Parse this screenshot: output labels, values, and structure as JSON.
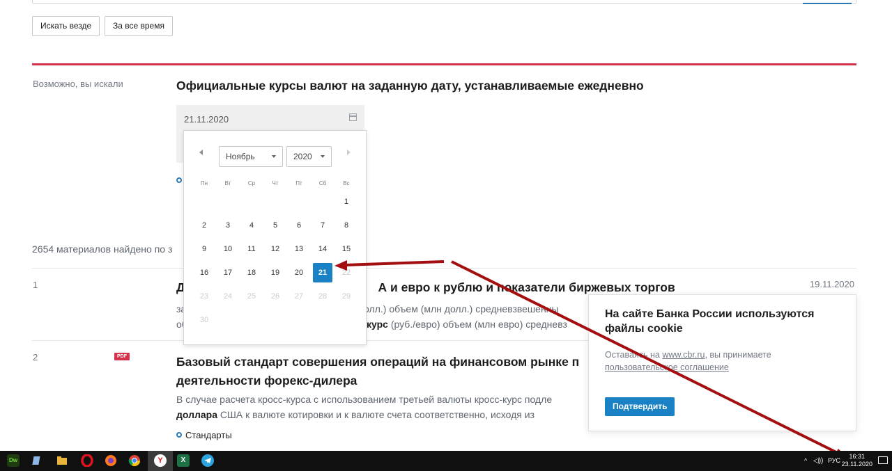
{
  "filters": {
    "search_everywhere": "Искать везде",
    "all_time": "За все время"
  },
  "suggestion": {
    "label": "Возможно, вы искали",
    "title": "Официальные курсы валют на заданную дату, устанавливаемые ежедневно",
    "date_value": "21.11.2020"
  },
  "datepicker": {
    "month": "Ноябрь",
    "year": "2020",
    "weekdays": [
      "Пн",
      "Вт",
      "Ср",
      "Чт",
      "Пт",
      "Сб",
      "Вс"
    ],
    "selected_day": "21",
    "days": [
      "1",
      "2",
      "3",
      "4",
      "5",
      "6",
      "7",
      "8",
      "9",
      "10",
      "11",
      "12",
      "13",
      "14",
      "15",
      "16",
      "17",
      "18",
      "19",
      "20",
      "21",
      "22",
      "23",
      "24",
      "25",
      "26",
      "27",
      "28",
      "29",
      "30"
    ]
  },
  "results": {
    "count_text": "2654 материалов найдено по з",
    "items": [
      {
        "num": "1",
        "title_left": "Д",
        "title_right": "А и евро к рублю и показатели биржевых торгов",
        "date": "19.11.2020",
        "line1_left": "за",
        "line1_right": "/долл.) объем (млн долл.) средневзвешенны",
        "line2_left": "об",
        "line2_bold": "курс",
        "line2_right": "(руб./евро) объем (млн евро) средневз"
      },
      {
        "num": "2",
        "badge": "PDF",
        "title": "Базовый стандарт совершения операций на финансовом рынке п деятельности форекс-дилера",
        "text_1": "В случае расчета кросс-курса с использованием третьей валюты кросс-курс подле",
        "text_bold": "доллара",
        "text_2": "США к валюте котировки и к валюте счета соответственно, исходя из",
        "tag": "Стандарты"
      }
    ]
  },
  "cookie": {
    "title": "На сайте Банка России используются файлы cookie",
    "body_1": "Оставаясь на",
    "site": "www.cbr.ru",
    "body_2": ", вы принимаете",
    "agreement": "пользовательское соглашение",
    "confirm": "Подтвердить"
  },
  "taskbar": {
    "apps": [
      "dreamweaver-icon",
      "folder-icon",
      "explorer-icon",
      "opera-icon",
      "firefox-icon",
      "chrome-icon",
      "yandex-browser-icon",
      "excel-icon",
      "telegram-icon"
    ],
    "lang": "РУС",
    "time": "16:31",
    "date": "23.11.2020"
  },
  "colors": {
    "accent_red": "#d3314c",
    "accent_blue": "#1a82c4",
    "annotation_arrow": "#a30f10"
  }
}
